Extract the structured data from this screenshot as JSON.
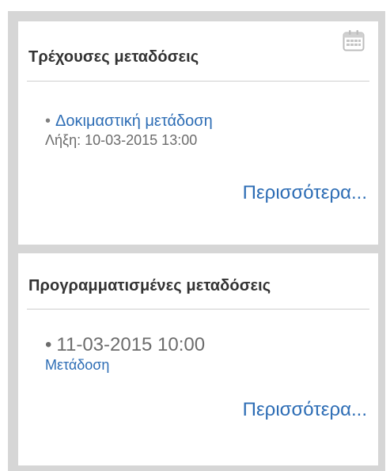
{
  "current": {
    "title": "Τρέχουσες μεταδόσεις",
    "icon": "calendar-icon",
    "item_link": "Δοκιμαστική μετάδοση",
    "item_expiry": "Λήξη: 10-03-2015 13:00",
    "more": "Περισσότερα..."
  },
  "scheduled": {
    "title": "Προγραμματισμένες μεταδόσεις",
    "item_date": "11-03-2015 10:00",
    "item_link": "Μετάδοση",
    "more": "Περισσότερα..."
  },
  "colors": {
    "link": "#2d6db5",
    "title": "#333333",
    "muted": "#6c6c6c",
    "panel_background": "#d6d6d6"
  }
}
